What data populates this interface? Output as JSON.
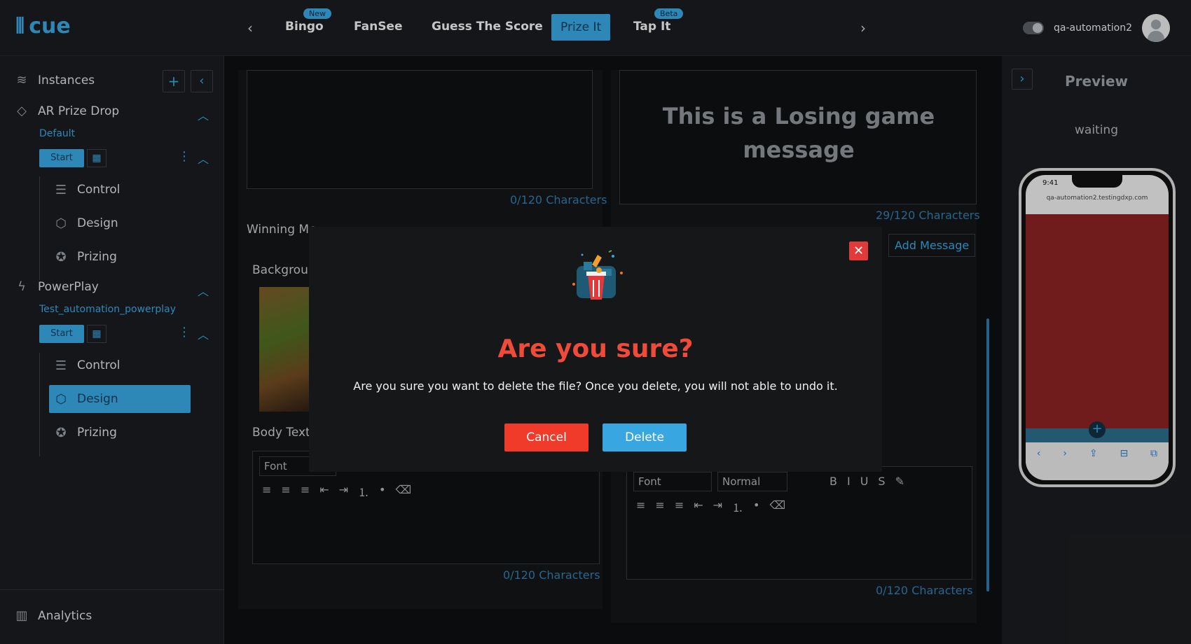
{
  "app": {
    "logo_text": "cue"
  },
  "nav": {
    "tabs": [
      {
        "label": "Bingo",
        "badge": "New"
      },
      {
        "label": "FanSee"
      },
      {
        "label": "Guess The Score"
      },
      {
        "label": "Prize It",
        "active": true
      },
      {
        "label": "Tap It",
        "badge": "Beta"
      }
    ]
  },
  "user": {
    "name": "qa-automation2"
  },
  "sidebar": {
    "instances_label": "Instances",
    "group1": {
      "title": "AR Prize Drop",
      "subtitle": "Default",
      "start_label": "Start",
      "items": [
        "Control",
        "Design",
        "Prizing"
      ]
    },
    "group2": {
      "title": "PowerPlay",
      "subtitle": "Test_automation_powerplay",
      "start_label": "Start",
      "items": [
        "Control",
        "Design",
        "Prizing"
      ],
      "active_item": "Design"
    },
    "analytics_label": "Analytics"
  },
  "main": {
    "left_top_count": "0/120 Characters",
    "right_top_message": "This is a Losing game message",
    "right_top_count": "29/120 Characters",
    "winning_label": "Winning Me",
    "add_message_label": "Add Message",
    "background_label": "Backgrour",
    "body_text_label": "Body Text",
    "font_placeholder": "Font",
    "normal_placeholder": "Normal",
    "left_bottom_count": "0/120 Characters",
    "right_bottom_count": "0/120 Characters"
  },
  "preview": {
    "title": "Preview",
    "status": "waiting",
    "phone_time": "9:41",
    "phone_url": "qa-automation2.testingdxp.com"
  },
  "modal": {
    "title": "Are you sure?",
    "text": "Are you sure you want to delete the file? Once you delete, you will not able to undo it.",
    "cancel_label": "Cancel",
    "delete_label": "Delete"
  },
  "colors": {
    "accent": "#38a6e0",
    "danger": "#f03a2a",
    "title_red": "#f04a3a"
  }
}
